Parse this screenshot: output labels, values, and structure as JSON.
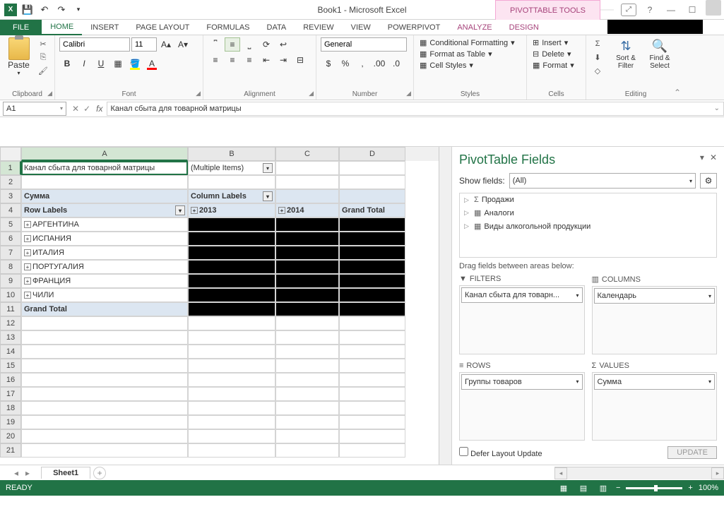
{
  "title": "Book1 - Microsoft Excel",
  "pivot_tools": "PIVOTTABLE TOOLS",
  "tabs": {
    "file": "FILE",
    "home": "HOME",
    "insert": "INSERT",
    "page_layout": "PAGE LAYOUT",
    "formulas": "FORMULAS",
    "data": "DATA",
    "review": "REVIEW",
    "view": "VIEW",
    "powerpivot": "POWERPIVOT",
    "analyze": "ANALYZE",
    "design": "DESIGN"
  },
  "ribbon": {
    "clipboard": {
      "paste": "Paste",
      "label": "Clipboard"
    },
    "font": {
      "name": "Calibri",
      "size": "11",
      "label": "Font"
    },
    "alignment": {
      "label": "Alignment"
    },
    "number": {
      "format": "General",
      "label": "Number"
    },
    "styles": {
      "cond": "Conditional Formatting",
      "table": "Format as Table",
      "cell": "Cell Styles",
      "label": "Styles"
    },
    "cells": {
      "insert": "Insert",
      "delete": "Delete",
      "format": "Format",
      "label": "Cells"
    },
    "editing": {
      "sort": "Sort & Filter",
      "find": "Find & Select",
      "label": "Editing"
    }
  },
  "namebox": "A1",
  "formula": "Канал сбыта для товарной матрицы",
  "cols": {
    "A": "A",
    "B": "B",
    "C": "C",
    "D": "D"
  },
  "rows": {
    "1": {
      "A": "Канал сбыта для товарной матрицы",
      "B": "(Multiple Items)"
    },
    "3": {
      "A": "Сумма",
      "B": "Column Labels"
    },
    "4": {
      "A": "Row Labels",
      "B": "2013",
      "C": "2014",
      "D": "Grand Total"
    },
    "5": {
      "A": "АРГЕНТИНА"
    },
    "6": {
      "A": "ИСПАНИЯ"
    },
    "7": {
      "A": "ИТАЛИЯ"
    },
    "8": {
      "A": "ПОРТУГАЛИЯ"
    },
    "9": {
      "A": "ФРАНЦИЯ"
    },
    "10": {
      "A": "ЧИЛИ"
    },
    "11": {
      "A": "Grand Total"
    }
  },
  "pane": {
    "title": "PivotTable Fields",
    "show_fields": "Show fields:",
    "show_value": "(All)",
    "fields": {
      "f1": "Продажи",
      "f2": "Аналоги",
      "f3": "Виды алкогольной продукции"
    },
    "drag_label": "Drag fields between areas below:",
    "zones": {
      "filters": "FILTERS",
      "columns": "COLUMNS",
      "rows": "ROWS",
      "values": "VALUES"
    },
    "items": {
      "filter": "Канал сбыта для товарн...",
      "column": "Календарь",
      "row": "Группы товаров",
      "value": "Сумма"
    },
    "defer": "Defer Layout Update",
    "update": "UPDATE"
  },
  "sheet": "Sheet1",
  "status": "READY",
  "zoom": "100%"
}
